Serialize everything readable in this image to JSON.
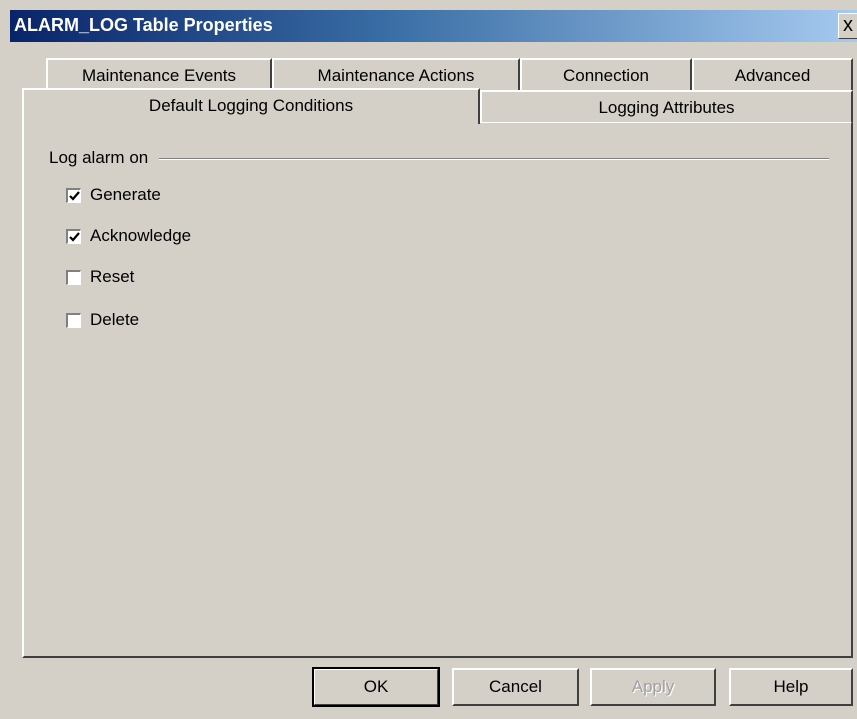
{
  "window": {
    "title": "ALARM_LOG Table Properties",
    "close_label": "x"
  },
  "tabs": {
    "row1": [
      "Maintenance Events",
      "Maintenance Actions",
      "Connection",
      "Advanced"
    ],
    "row2": [
      "Default Logging Conditions",
      "Logging Attributes"
    ],
    "active": "Default Logging Conditions"
  },
  "group": {
    "label": "Log alarm on",
    "checkboxes": [
      {
        "label": "Generate",
        "checked": true
      },
      {
        "label": "Acknowledge",
        "checked": true
      },
      {
        "label": "Reset",
        "checked": false
      },
      {
        "label": "Delete",
        "checked": false
      }
    ]
  },
  "buttons": {
    "ok": "OK",
    "cancel": "Cancel",
    "apply": "Apply",
    "help": "Help"
  }
}
